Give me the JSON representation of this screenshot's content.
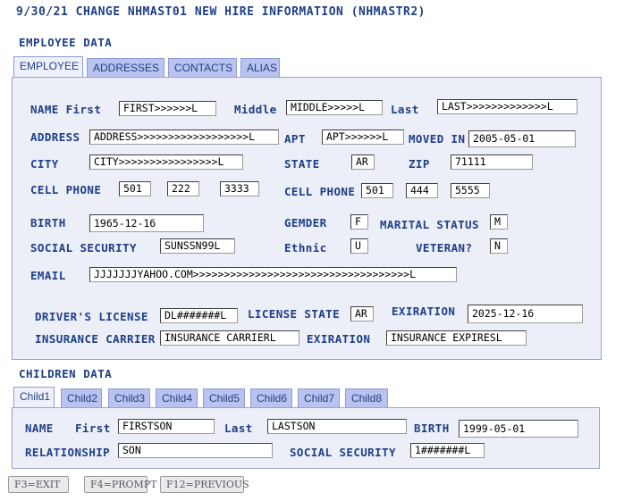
{
  "header": {
    "title": "9/30/21 CHANGE NHMAST01 NEW HIRE INFORMATION (NHMASTR2)"
  },
  "employee_section": {
    "heading": "EMPLOYEE DATA"
  },
  "employee_tabs": [
    "EMPLOYEE",
    "ADDRESSES",
    "CONTACTS",
    "ALIAS"
  ],
  "employee": {
    "name_label": "NAME First",
    "first": "FIRST>>>>>>L",
    "middle_label": "Middle",
    "middle": "MIDDLE>>>>>L",
    "last_label": "Last",
    "last": "LAST>>>>>>>>>>>>>L",
    "address_label": "ADDRESS",
    "address": "ADDRESS>>>>>>>>>>>>>>>>>>L",
    "apt_label": "APT",
    "apt": "APT>>>>>>L",
    "moved_label": "MOVED IN",
    "moved": "2005-05-01",
    "city_label": "CITY",
    "city": "CITY>>>>>>>>>>>>>>>>L",
    "state_label": "STATE",
    "state": "AR",
    "zip_label": "ZIP",
    "zip": "71111",
    "cell1_label": "CELL PHONE",
    "cell1_a": "501",
    "cell1_b": "222",
    "cell1_c": "3333",
    "cell2_label": "CELL PHONE",
    "cell2_a": "501",
    "cell2_b": "444",
    "cell2_c": "5555",
    "birth_label": "BIRTH",
    "birth": "1965-12-16",
    "gender_label": "GEMDER",
    "gender": "F",
    "marital_label": "MARITAL STATUS",
    "marital": "M",
    "ssn_label": "SOCIAL SECURITY",
    "ssn": "SUNSSN99L",
    "ethnic_label": "Ethnic",
    "ethnic": "U",
    "veteran_label": "VETERAN?",
    "veteran": "N",
    "email_label": "EMAIL",
    "email": "JJJJJJJYAHOO.COM>>>>>>>>>>>>>>>>>>>>>>>>>>>>>>>>>>>L",
    "dl_label": "DRIVER'S LICENSE",
    "dl": "DL#######L",
    "license_state_label": "LICENSE STATE",
    "license_state": "AR",
    "exiration_label": "EXIRATION",
    "exiration": "2025-12-16",
    "insurance_label": "INSURANCE CARRIER",
    "insurance": "INSURANCE CARRIERL",
    "ins_exiration_label": "EXIRATION",
    "ins_exiration": "INSURANCE EXPIRESL"
  },
  "children_section": {
    "heading": "CHILDREN DATA"
  },
  "children_tabs": [
    "Child1",
    "Child2",
    "Child3",
    "Child4",
    "Child5",
    "Child6",
    "Child7",
    "Child8"
  ],
  "child": {
    "name_label": "NAME",
    "first_label": "First",
    "first": "FIRSTSON",
    "last_label": "Last",
    "last": "LASTSON",
    "birth_label": "BIRTH",
    "birth": "1999-05-01",
    "relationship_label": "RELATIONSHIP",
    "relationship": "SON",
    "ssn_label": "SOCIAL SECURITY",
    "ssn": "1#######L"
  },
  "function_keys": [
    "F3=EXIT",
    "F4=PROMPT",
    "F12=PREVIOUS"
  ]
}
